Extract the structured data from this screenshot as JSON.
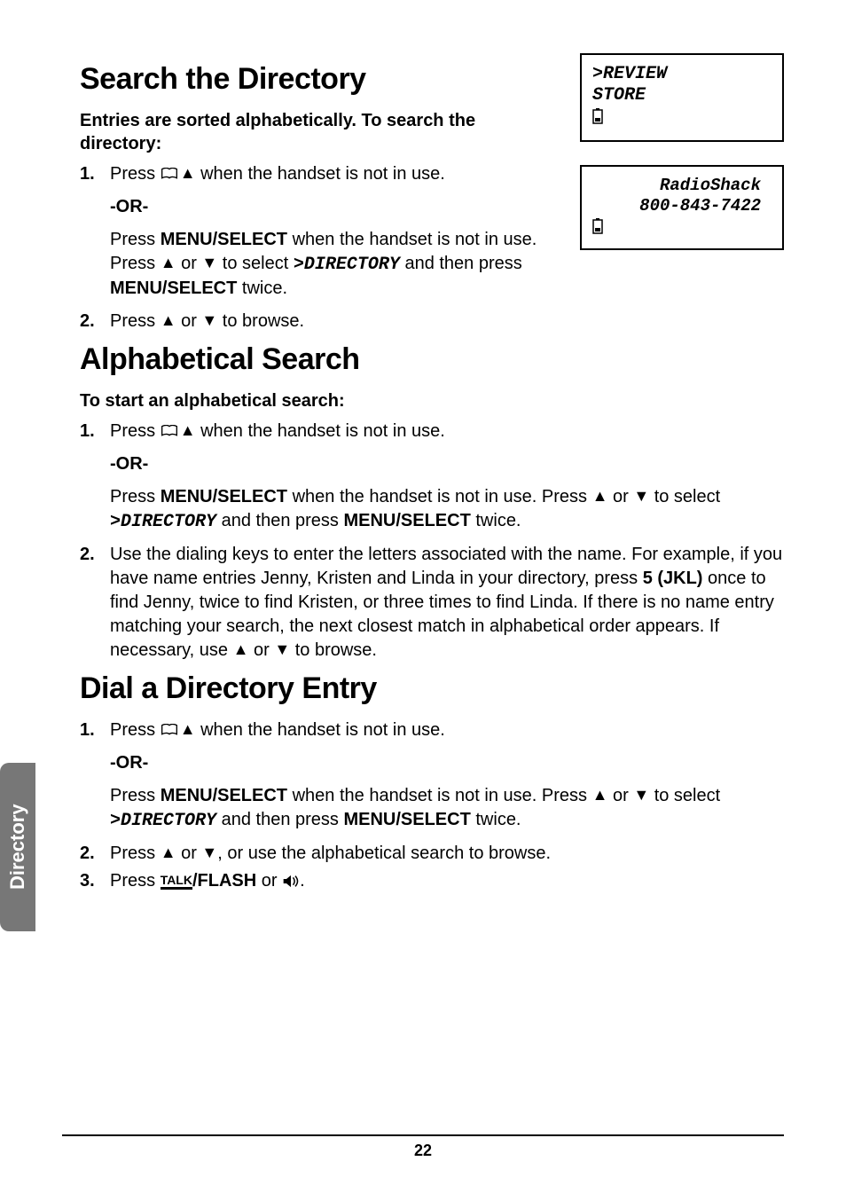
{
  "sideTab": "Directory",
  "pageNumber": "22",
  "lcd1": {
    "line1": ">REVIEW",
    "line2": " STORE"
  },
  "lcd2": {
    "line1": "RadioShack",
    "line2": "800-843-7422"
  },
  "sec1": {
    "heading": "Search the Directory",
    "intro": "Entries are sorted alphabetically. To search the directory:",
    "step1a": "Press ",
    "step1b": " when the handset is not in use.",
    "or": "-OR-",
    "step1c_a": "Press ",
    "step1c_b": "MENU/SELECT",
    "step1c_c": " when the handset is not in use. Press ",
    "step1c_d": " or ",
    "step1c_e": " to select ",
    "step1c_menu": ">DIRECTORY",
    "step1c_f": " and then press ",
    "step1c_g": "MENU/SELECT",
    "step1c_h": " twice.",
    "step2a": "Press ",
    "step2b": " or ",
    "step2c": " to browse."
  },
  "sec2": {
    "heading": "Alphabetical Search",
    "intro": "To start an alphabetical search:",
    "step1a": "Press ",
    "step1b": " when the handset is not in use.",
    "or": "-OR-",
    "step1c_a": "Press ",
    "step1c_b": "MENU/SELECT",
    "step1c_c": " when the handset is not in use. Press ",
    "step1c_d": " or ",
    "step1c_e": " to select ",
    "step1c_menu": ">DIRECTORY",
    "step1c_f": " and then press ",
    "step1c_g": "MENU/SELECT",
    "step1c_h": " twice.",
    "step2a": "Use the dialing keys to enter the letters associated with the name. For example, if you have name entries Jenny, Kristen and Linda in your directory, press ",
    "step2b": "5 (JKL)",
    "step2c": " once to find Jenny, twice to find Kristen, or three times to find Linda. If there is no name entry matching your search, the next closest match in alphabetical order appears. If necessary, use ",
    "step2d": " or ",
    "step2e": " to browse."
  },
  "sec3": {
    "heading": "Dial a Directory Entry",
    "step1a": "Press ",
    "step1b": " when the handset is not in use.",
    "or": "-OR-",
    "step1c_a": "Press ",
    "step1c_b": "MENU/SELECT",
    "step1c_c": " when the handset is not in use. Press ",
    "step1c_d": " or ",
    "step1c_e": " to select ",
    "step1c_menu": ">DIRECTORY",
    "step1c_f": " and then press ",
    "step1c_g": "MENU/SELECT",
    "step1c_h": " twice.",
    "step2a": "Press ",
    "step2b": " or ",
    "step2c": ", or use the alphabetical search to browse.",
    "step3a": "Press ",
    "step3b": "/FLASH",
    "step3c": " or ",
    "step3d": "."
  },
  "nums": {
    "n1": "1.",
    "n2": "2.",
    "n3": "3."
  }
}
